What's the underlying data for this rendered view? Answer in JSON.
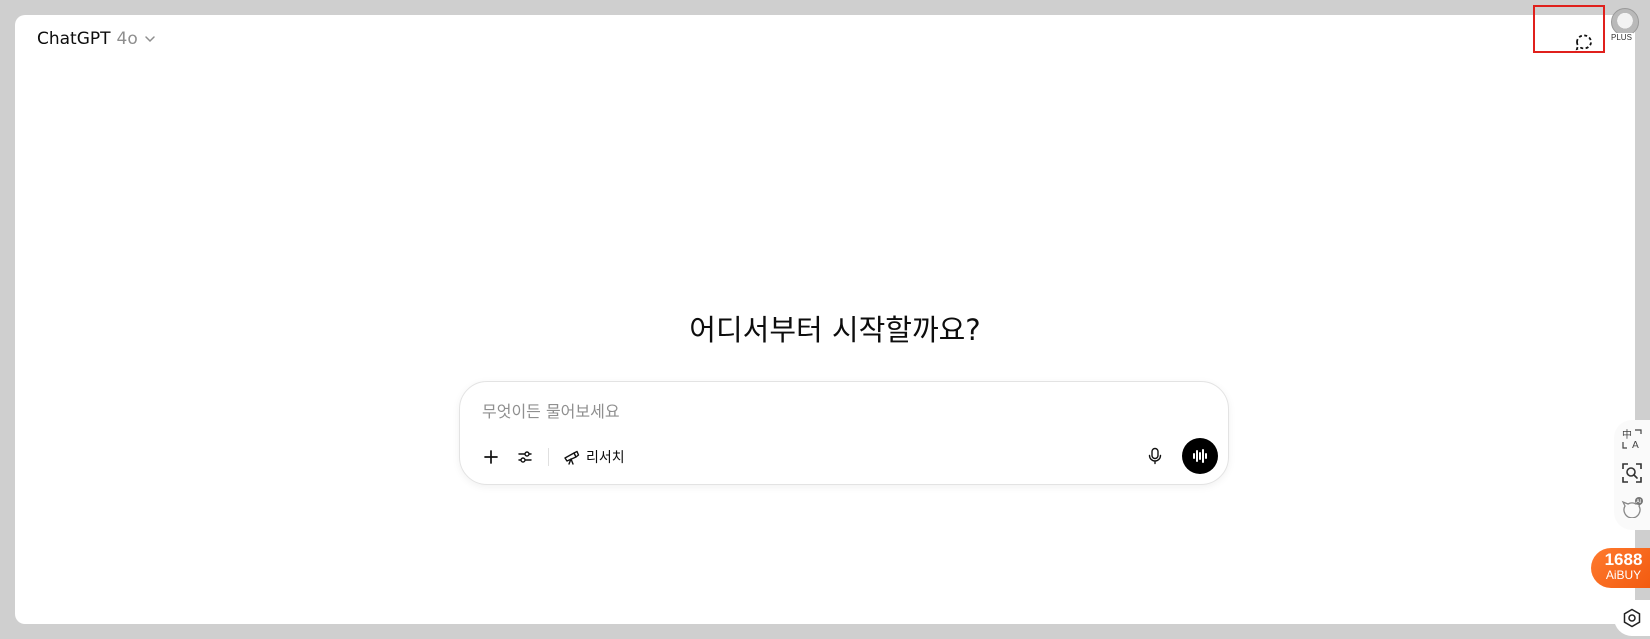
{
  "header": {
    "model_name": "ChatGPT",
    "model_version": "4o",
    "plan_badge": "PLUS"
  },
  "main": {
    "headline": "어디서부터 시작할까요?"
  },
  "composer": {
    "placeholder": "무엇이든 물어보세요",
    "research_label": "리서치"
  },
  "side_widget": {
    "aibuy_number": "1688",
    "aibuy_label": "AiBUY"
  },
  "colors": {
    "highlight": "#e0201c",
    "aibuy_accent": "#f25b10",
    "voice_button": "#000000"
  },
  "icons": [
    "chevron-down-icon",
    "temporary-chat-icon",
    "plus-icon",
    "tools-sliders-icon",
    "telescope-icon",
    "microphone-icon",
    "voice-waveform-icon",
    "translate-icon",
    "search-scan-icon",
    "ai-cat-icon",
    "settings-hexagon-icon"
  ]
}
